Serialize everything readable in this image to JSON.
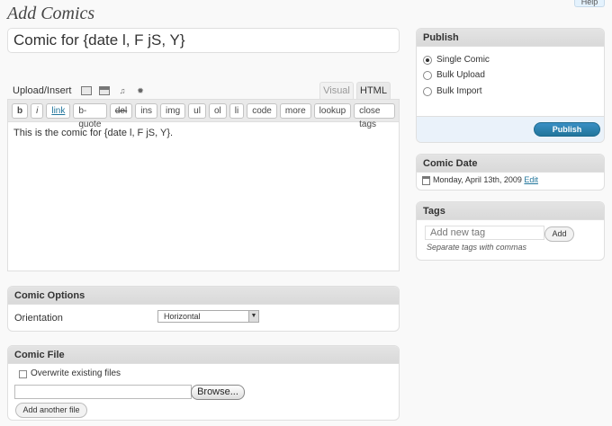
{
  "page": {
    "title": "Add Comics",
    "help": "Help"
  },
  "post_title": "Comic for {date l, F jS, Y}",
  "upload": {
    "label": "Upload/Insert"
  },
  "editor": {
    "tab_visual": "Visual",
    "tab_html": "HTML",
    "quicktags": [
      "b",
      "i",
      "link",
      "b-quote",
      "del",
      "ins",
      "img",
      "ul",
      "ol",
      "li",
      "code",
      "more",
      "lookup",
      "close tags"
    ],
    "content": "This is the comic for {date l, F jS, Y}."
  },
  "comic_options": {
    "title": "Comic Options",
    "orientation_label": "Orientation",
    "orientation_value": "Horizontal"
  },
  "comic_file": {
    "title": "Comic File",
    "overwrite_label": "Overwrite existing files",
    "browse_label": "Browse...",
    "add_another_label": "Add another file"
  },
  "publish": {
    "title": "Publish",
    "options": [
      "Single Comic",
      "Bulk Upload",
      "Bulk Import"
    ],
    "selected": "Single Comic",
    "button_label": "Publish"
  },
  "comic_date": {
    "title": "Comic Date",
    "date_text": "Monday, April 13th, 2009",
    "edit_label": "Edit"
  },
  "tags": {
    "title": "Tags",
    "placeholder": "Add new tag",
    "add_label": "Add",
    "hint": "Separate tags with commas"
  },
  "colors": {
    "accent": "#21759b",
    "publish_button": "#2a7fb3"
  }
}
